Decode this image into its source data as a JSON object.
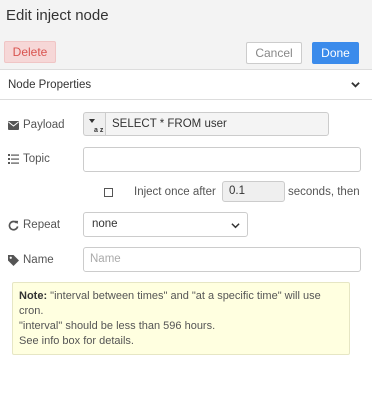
{
  "dialog": {
    "title": "Edit inject node",
    "delete_label": "Delete",
    "cancel_label": "Cancel",
    "done_label": "Done"
  },
  "section": {
    "title": "Node Properties",
    "chevron_icon": "chevron-down-icon"
  },
  "fields": {
    "payload": {
      "label": "Payload",
      "icon": "envelope-icon",
      "type_marker": "a z",
      "value": "SELECT * FROM user"
    },
    "topic": {
      "label": "Topic",
      "icon": "tasks-icon",
      "value": ""
    },
    "inject_once": {
      "checked": false,
      "label": "Inject once after",
      "value": "0.1",
      "suffix": "seconds, then"
    },
    "repeat": {
      "label": "Repeat",
      "icon": "repeat-icon",
      "selected": "none"
    },
    "name": {
      "label": "Name",
      "icon": "tag-icon",
      "placeholder": "Name"
    }
  },
  "tip": {
    "strong": "Note:",
    "line1": " \"interval between times\" and \"at a specific time\" will use cron.",
    "line2": "\"interval\" should be less than 596 hours.",
    "line3": "See info box for details."
  },
  "colors": {
    "done": "#3b8beb",
    "delete_bg": "#f6d7d7",
    "delete_text": "#d9534f",
    "tip_bg": "#ffffe0"
  }
}
